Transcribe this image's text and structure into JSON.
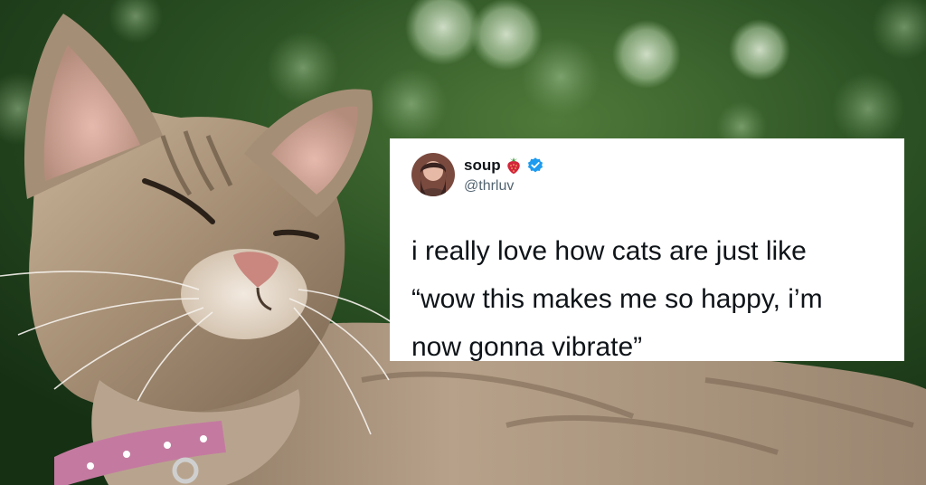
{
  "tweet": {
    "display_name": "soup",
    "handle": "@thrluv",
    "emoji_icon": "strawberry-icon",
    "badge_icon": "verified-badge-icon",
    "text_lines": [
      "i really love how cats are just like",
      "“wow this makes me so happy, i’m",
      "now gonna vibrate”"
    ]
  },
  "colors": {
    "card_background": "#ffffff",
    "text": "#0f1419",
    "handle": "#536471",
    "verified": "#1d9bf0",
    "background_foliage": "#24421f"
  }
}
